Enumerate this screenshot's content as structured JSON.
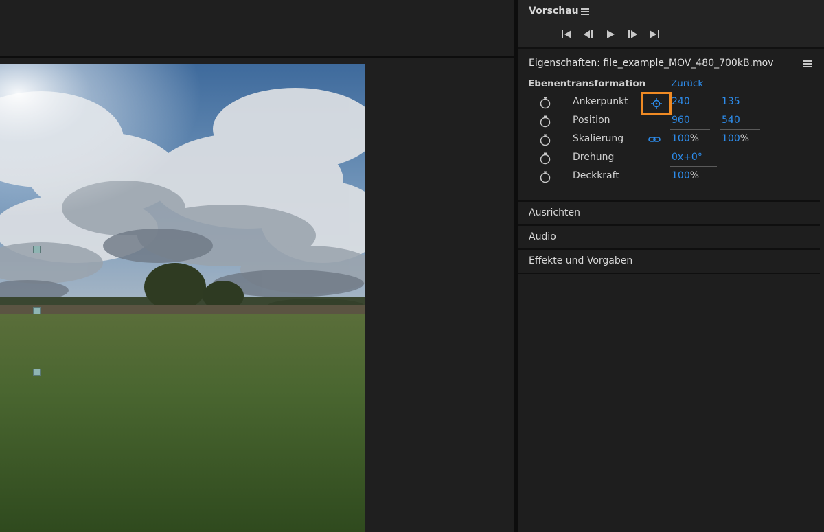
{
  "preview": {
    "title": "Vorschau",
    "buttons": [
      "go-to-start",
      "step-back",
      "play",
      "step-forward",
      "go-to-end"
    ]
  },
  "properties": {
    "title": "Eigenschaften: file_example_MOV_480_700kB.mov",
    "section_label": "Ebenentransformation",
    "back_label": "Zurück",
    "rows": [
      {
        "label": "Ankerpunkt",
        "value1": "240",
        "value2": "135"
      },
      {
        "label": "Position",
        "value1": "960",
        "value2": "540"
      },
      {
        "label": "Skalierung",
        "value1": "100",
        "unit1": "%",
        "value2": "100",
        "unit2": "%"
      },
      {
        "label": "Drehung",
        "value1": "0x+0°"
      },
      {
        "label": "Deckkraft",
        "value1": "100",
        "unit1": "%"
      }
    ]
  },
  "accordions": {
    "align": "Ausrichten",
    "audio": "Audio",
    "effects": "Effekte und Vorgaben"
  },
  "colors": {
    "accent_blue": "#2d8ceb",
    "highlight_orange": "#ef8a24",
    "panel_bg": "#1e1e1e"
  }
}
